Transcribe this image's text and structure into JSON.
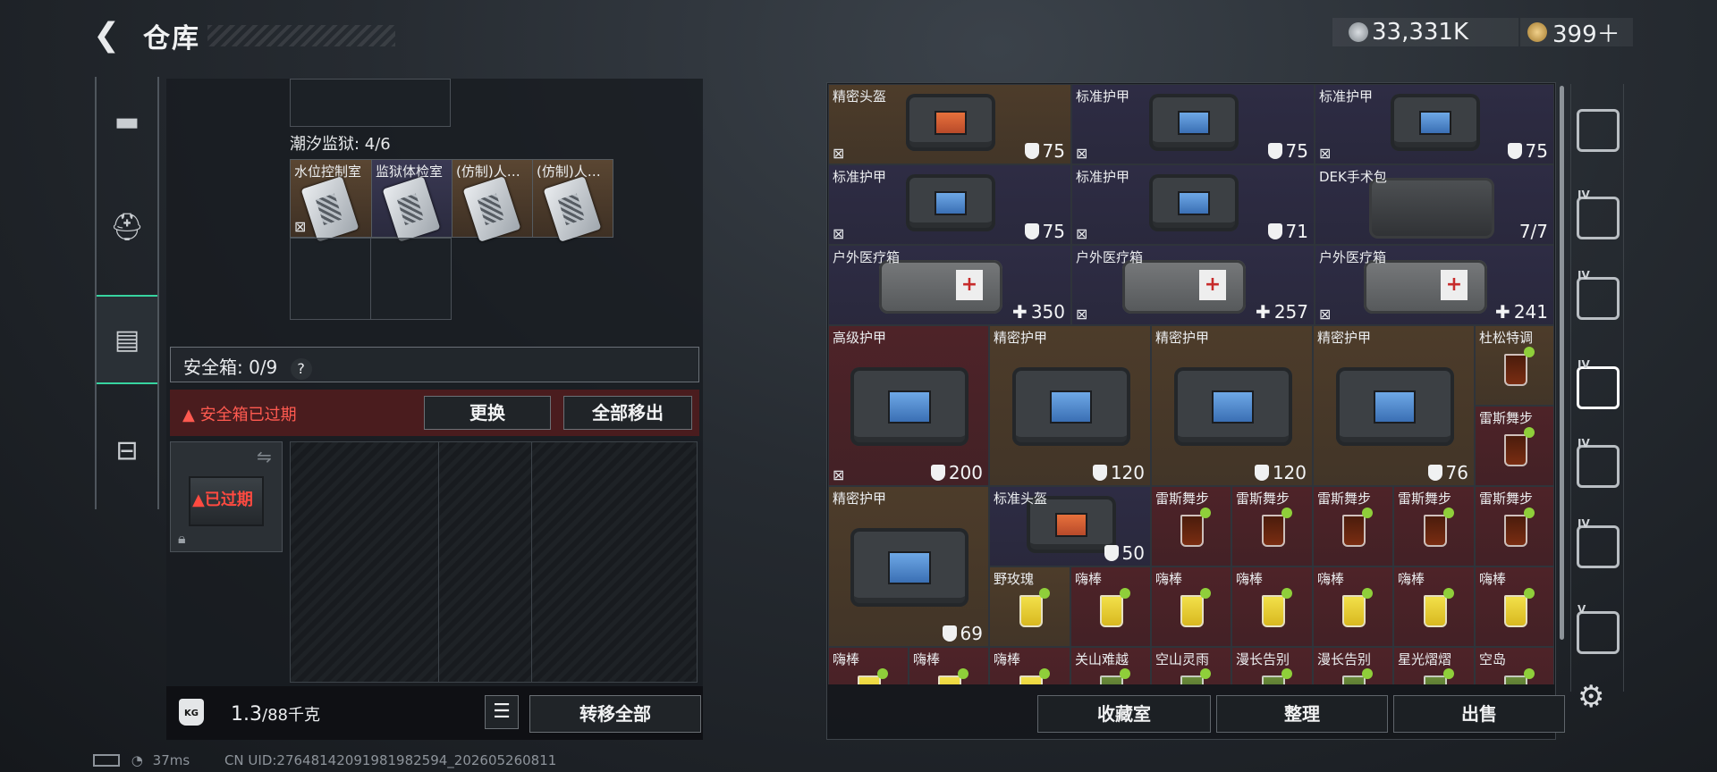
{
  "header": {
    "title": "仓库",
    "currency1_value": "33,331K",
    "currency2_value": "399＋"
  },
  "left_panel": {
    "region_label": "潮汐监狱: 4/6",
    "region_items": [
      {
        "label": "水位控制室"
      },
      {
        "label": "监狱体检室"
      },
      {
        "label": "(仿制)人…"
      },
      {
        "label": "(仿制)人…"
      }
    ],
    "safe_label": "安全箱: 0/9",
    "safe_help": "?",
    "warning_text": "安全箱已过期",
    "replace_button": "更换",
    "remove_all_button": "全部移出",
    "expired_label": "已过期",
    "weight_current": "1.3",
    "weight_max": "/88千克",
    "transfer_all_button": "转移全部"
  },
  "status_bar": {
    "ping": "37ms",
    "uid": "CN UID:27648142091981982594_202605260811"
  },
  "stash": {
    "items": [
      {
        "label": "精密头盔",
        "value": "75"
      },
      {
        "label": "标准护甲",
        "value": "75"
      },
      {
        "label": "标准护甲",
        "value": "75"
      },
      {
        "label": "标准护甲",
        "value": "75"
      },
      {
        "label": "标准护甲",
        "value": "71"
      },
      {
        "label": "DEK手术包",
        "value": "7/7"
      },
      {
        "label": "户外医疗箱",
        "value": "350"
      },
      {
        "label": "户外医疗箱",
        "value": "257"
      },
      {
        "label": "户外医疗箱",
        "value": "241"
      },
      {
        "label": "高级护甲",
        "value": "200"
      },
      {
        "label": "精密护甲",
        "value": "120"
      },
      {
        "label": "精密护甲",
        "value": "120"
      },
      {
        "label": "精密护甲",
        "value": "76"
      },
      {
        "label": "杜松特调",
        "value": ""
      },
      {
        "label": "雷斯舞步",
        "value": ""
      },
      {
        "label": "精密护甲",
        "value": "69"
      },
      {
        "label": "标准头盔",
        "value": "50"
      },
      {
        "label": "雷斯舞步",
        "value": ""
      },
      {
        "label": "雷斯舞步",
        "value": ""
      },
      {
        "label": "雷斯舞步",
        "value": ""
      },
      {
        "label": "雷斯舞步",
        "value": ""
      },
      {
        "label": "雷斯舞步",
        "value": ""
      },
      {
        "label": "野玫瑰",
        "value": ""
      },
      {
        "label": "嗨棒",
        "value": ""
      },
      {
        "label": "嗨棒",
        "value": ""
      },
      {
        "label": "嗨棒",
        "value": ""
      },
      {
        "label": "嗨棒",
        "value": ""
      },
      {
        "label": "嗨棒",
        "value": ""
      },
      {
        "label": "嗨棒",
        "value": ""
      },
      {
        "label": "嗨棒",
        "value": ""
      },
      {
        "label": "嗨棒",
        "value": ""
      },
      {
        "label": "嗨棒",
        "value": ""
      },
      {
        "label": "关山难越",
        "value": ""
      },
      {
        "label": "空山灵雨",
        "value": ""
      },
      {
        "label": "漫长告别",
        "value": ""
      },
      {
        "label": "漫长告别",
        "value": ""
      },
      {
        "label": "星光熠熠",
        "value": ""
      },
      {
        "label": "空岛",
        "value": ""
      }
    ],
    "buttons": {
      "collection": "收藏室",
      "sort": "整理",
      "sell": "出售"
    }
  },
  "right_tabs": [
    {
      "roman": ""
    },
    {
      "roman": "IV"
    },
    {
      "roman": "IV"
    },
    {
      "roman": "IV"
    },
    {
      "roman": "IV"
    },
    {
      "roman": "IV"
    },
    {
      "roman": "V"
    }
  ],
  "colors": {
    "gold_tier": "#4d3c2a",
    "purple_tier": "#2e2c44",
    "red_tier": "#4e2328",
    "accent": "#37d4a0",
    "warning": "#ff5a50"
  }
}
